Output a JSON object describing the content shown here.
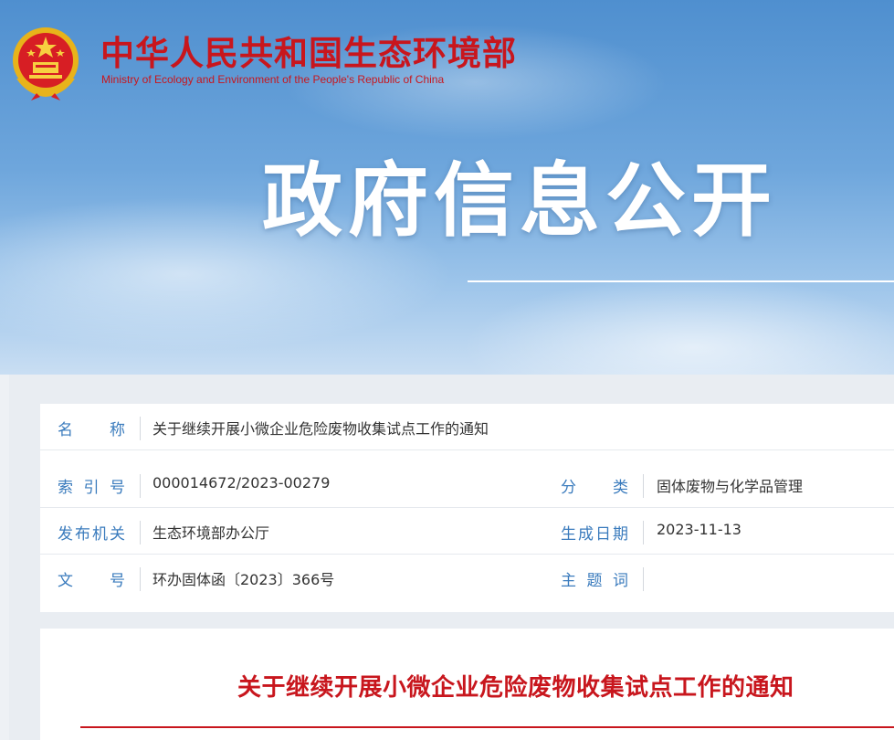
{
  "header": {
    "site_title": "中华人民共和国生态环境部",
    "site_subtitle": "Ministry of Ecology and Environment of the People's Republic of China",
    "hero_text": "政府信息公开",
    "emblem_icon": "national-emblem-icon"
  },
  "info": {
    "name_label": "名称",
    "name_value": "关于继续开展小微企业危险废物收集试点工作的通知",
    "index_label": "索引号",
    "index_value": "000014672/2023-00279",
    "category_label": "分类",
    "category_value": "固体废物与化学品管理",
    "issuer_label": "发布机关",
    "issuer_value": "生态环境部办公厅",
    "date_label": "生成日期",
    "date_value": "2023-11-13",
    "docno_label": "文号",
    "docno_value": "环办固体函〔2023〕366号",
    "keywords_label": "主题词",
    "keywords_value": ""
  },
  "article": {
    "title": "关于继续开展小微企业危险废物收集试点工作的通知"
  },
  "colors": {
    "brand_red": "#c8161d",
    "label_blue": "#3a7bbd",
    "text": "#333333"
  }
}
